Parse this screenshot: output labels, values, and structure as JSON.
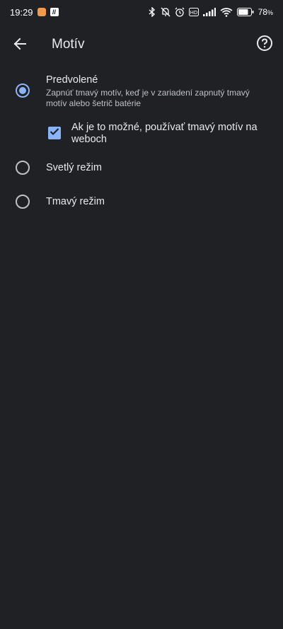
{
  "status_bar": {
    "time": "19:29",
    "battery": "78"
  },
  "app_bar": {
    "title": "Motív",
    "back_icon": "arrow-back-icon",
    "help_icon": "help-circle-icon"
  },
  "theme_options": {
    "default": {
      "label": "Predvolené",
      "description": "Zapnúť tmavý motív, keď je v zariadení zapnutý tmavý motív alebo šetrič batérie",
      "selected": true
    },
    "dark_web_checkbox": {
      "label": "Ak je to možné, používať tmavý motív na weboch",
      "checked": true
    },
    "light": {
      "label": "Svetlý režim",
      "selected": false
    },
    "dark": {
      "label": "Tmavý režim",
      "selected": false
    }
  },
  "colors": {
    "background": "#202124",
    "accent": "#8ab4f8"
  }
}
